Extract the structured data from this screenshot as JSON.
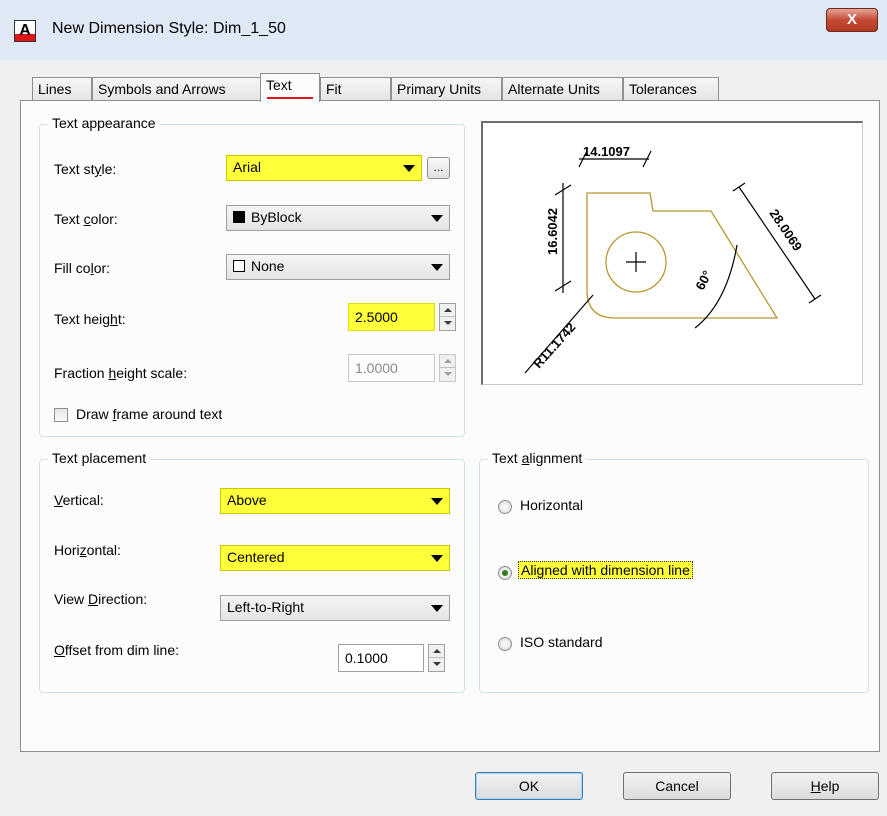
{
  "window": {
    "title": "New Dimension Style: Dim_1_50",
    "app_icon_letter": "A",
    "close_glyph": "X"
  },
  "tabs": [
    {
      "label": "Lines"
    },
    {
      "label": "Symbols and Arrows"
    },
    {
      "label": "Text",
      "active": true
    },
    {
      "label": "Fit"
    },
    {
      "label": "Primary Units"
    },
    {
      "label": "Alternate Units"
    },
    {
      "label": "Tolerances"
    }
  ],
  "text_appearance": {
    "title": "Text appearance",
    "text_style": {
      "label_pre": "Text st",
      "label_key": "y",
      "label_post": "le:",
      "value": "Arial",
      "ellipsis": "..."
    },
    "text_color": {
      "label_pre": "Text ",
      "label_key": "c",
      "label_post": "olor:",
      "value": "ByBlock"
    },
    "fill_color": {
      "label_pre": "Fill co",
      "label_key": "l",
      "label_post": "or:",
      "value": "None"
    },
    "text_height": {
      "label_pre": "Text heig",
      "label_key": "h",
      "label_post": "t:",
      "value": "2.5000"
    },
    "fraction_height_scale": {
      "label_pre": "Fraction ",
      "label_key": "h",
      "label_post": "eight scale:",
      "value": "1.0000"
    },
    "draw_frame": {
      "label_pre": "Draw ",
      "label_key": "f",
      "label_post": "rame around text",
      "checked": false
    }
  },
  "text_placement": {
    "title": "Text placement",
    "vertical": {
      "label_pre": "",
      "label_key": "V",
      "label_post": "ertical:",
      "value": "Above"
    },
    "horizontal": {
      "label_pre": "Hori",
      "label_key": "z",
      "label_post": "ontal:",
      "value": "Centered"
    },
    "view_direction": {
      "label_pre": "View ",
      "label_key": "D",
      "label_post": "irection:",
      "value": "Left-to-Right"
    },
    "offset": {
      "label_pre": "",
      "label_key": "O",
      "label_post": "ffset from dim line:",
      "value": "0.1000"
    }
  },
  "text_alignment": {
    "title_pre": "Text ",
    "title_key": "a",
    "title_post": "lignment",
    "options": [
      {
        "label": "Horizontal",
        "checked": false
      },
      {
        "label": "Aligned with dimension line",
        "checked": true
      },
      {
        "label": "ISO standard",
        "checked": false
      }
    ]
  },
  "preview": {
    "dim_top": "14.1097",
    "dim_left": "16.6042",
    "dim_right": "28.0069",
    "dim_angle": "60°",
    "dim_radius": "R11.1742"
  },
  "buttons": {
    "ok": "OK",
    "cancel": "Cancel",
    "help_key": "H",
    "help_post": "elp"
  },
  "colors": {
    "highlight": "#ffff3a",
    "tab_underline": "#e01515",
    "preview_outline": "#b8962e"
  }
}
